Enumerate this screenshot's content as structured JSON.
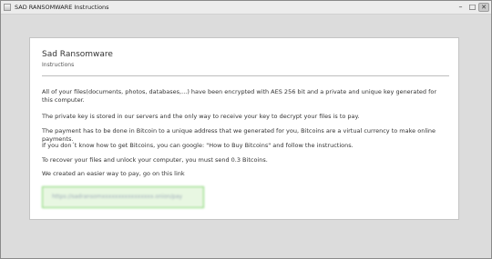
{
  "window": {
    "title": "SAD RANSOMWARE Instructions",
    "controls": {
      "minimize": "–",
      "maximize": "□",
      "close": "✕"
    }
  },
  "card": {
    "brand": "Sad Ransomware",
    "subtitle": "Instructions",
    "paragraphs": [
      "All of your files(documents, photos, databases,...) have been encrypted with AES 256 bit and a private and unique key generated for this computer.",
      "The private key is stored in our servers and the only way to receive your key to decrypt your files is to pay.",
      "The payment has to be done in Bitcoin to a unique address that we generated for you, Bitcoins are a virtual currency to make online payments.",
      "If you don´t know how to get Bitcoins, you can google: \"How to Buy Bitcoins\" and follow the instructions.",
      "To recover your files and unlock your computer, you must send 0.3 Bitcoins.",
      "We created an easier way to pay, go on this link"
    ],
    "payment_link": "https://sadransomxxxxxxxxxxxxxxxx.onion/pay"
  },
  "colors": {
    "link_background": "#e8f7e2",
    "link_border": "#7fd36b",
    "window_background": "#dcdcdc"
  }
}
